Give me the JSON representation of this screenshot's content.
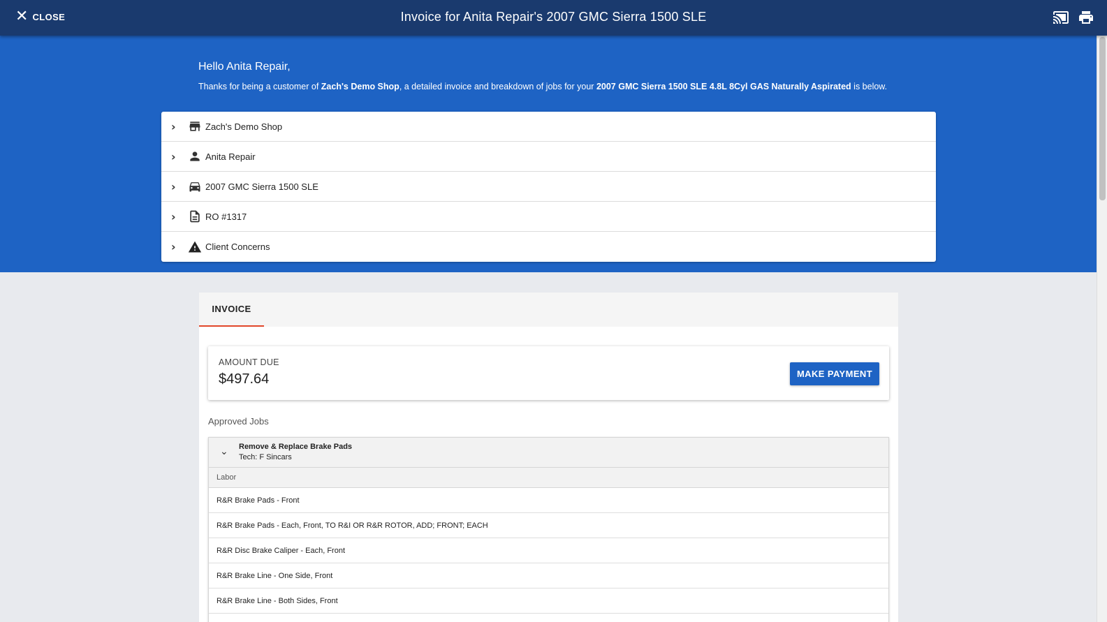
{
  "appbar": {
    "close_label": "CLOSE",
    "title": "Invoice for Anita Repair's 2007 GMC Sierra 1500 SLE",
    "icons": [
      "cast-icon",
      "print-icon"
    ]
  },
  "hero": {
    "greeting": "Hello Anita Repair,",
    "thanks_pre": "Thanks for being a customer of ",
    "shop_name": "Zach's Demo Shop",
    "thanks_mid": ", a detailed invoice and breakdown of jobs for your ",
    "vehicle_full": "2007 GMC Sierra 1500 SLE 4.8L 8Cyl GAS Naturally Aspirated",
    "thanks_post": " is below."
  },
  "accordion": {
    "items": [
      {
        "label": "Zach's Demo Shop",
        "icon": "store-icon"
      },
      {
        "label": "Anita Repair",
        "icon": "person-icon"
      },
      {
        "label": "2007 GMC Sierra 1500 SLE",
        "icon": "car-icon"
      },
      {
        "label": "RO #1317",
        "icon": "document-icon"
      },
      {
        "label": "Client Concerns",
        "icon": "warning-icon"
      }
    ]
  },
  "invoice": {
    "tab_label": "INVOICE",
    "amount_label": "AMOUNT DUE",
    "amount_value": "$497.64",
    "pay_label": "MAKE PAYMENT",
    "approved_label": "Approved Jobs",
    "job": {
      "title": "Remove & Replace Brake Pads",
      "tech": "Tech: F Sincars",
      "labor_header": "Labor",
      "labor_items": [
        "R&R Brake Pads - Front",
        "R&R Brake Pads - Each, Front, TO R&I OR R&R ROTOR, ADD; FRONT; EACH",
        "R&R Disc Brake Caliper - Each, Front",
        "R&R Brake Line - One Side, Front",
        "R&R Brake Line - Both Sides, Front"
      ]
    }
  },
  "colors": {
    "appbar": "#1a3a6e",
    "hero": "#1e63c4",
    "accent_tab": "#e1472a",
    "button": "#1e63c4"
  }
}
